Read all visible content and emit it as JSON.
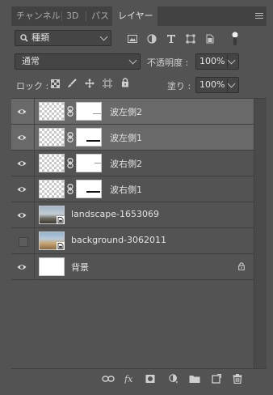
{
  "tabs": [
    "チャンネル",
    "3D",
    "パス",
    "レイヤー"
  ],
  "active_tab": 3,
  "filter": {
    "label": "種類"
  },
  "blend": {
    "mode": "通常"
  },
  "opacity": {
    "label": "不透明度 :",
    "value": "100%"
  },
  "lock": {
    "label": "ロック :"
  },
  "fill": {
    "label": "塗り :",
    "value": "100%"
  },
  "layers": [
    {
      "name": "波左側2",
      "visible": true,
      "selected": true,
      "type": "masked"
    },
    {
      "name": "波左側1",
      "visible": true,
      "selected": true,
      "type": "masked"
    },
    {
      "name": "波右側2",
      "visible": true,
      "selected": false,
      "type": "masked"
    },
    {
      "name": "波右側1",
      "visible": true,
      "selected": false,
      "type": "masked"
    },
    {
      "name": "landscape-1653069",
      "visible": true,
      "selected": false,
      "type": "smart"
    },
    {
      "name": "background-3062011",
      "visible": false,
      "selected": false,
      "type": "smart"
    },
    {
      "name": "背景",
      "visible": true,
      "selected": false,
      "type": "background",
      "locked": true
    }
  ],
  "bottom_icons": [
    "link-icon",
    "fx-icon",
    "mask-icon",
    "adjustment-icon",
    "folder-icon",
    "new-layer-icon",
    "trash-icon"
  ],
  "colors": {
    "panel": "#535353",
    "tabbar": "#424242",
    "selected_row": "#696969"
  }
}
